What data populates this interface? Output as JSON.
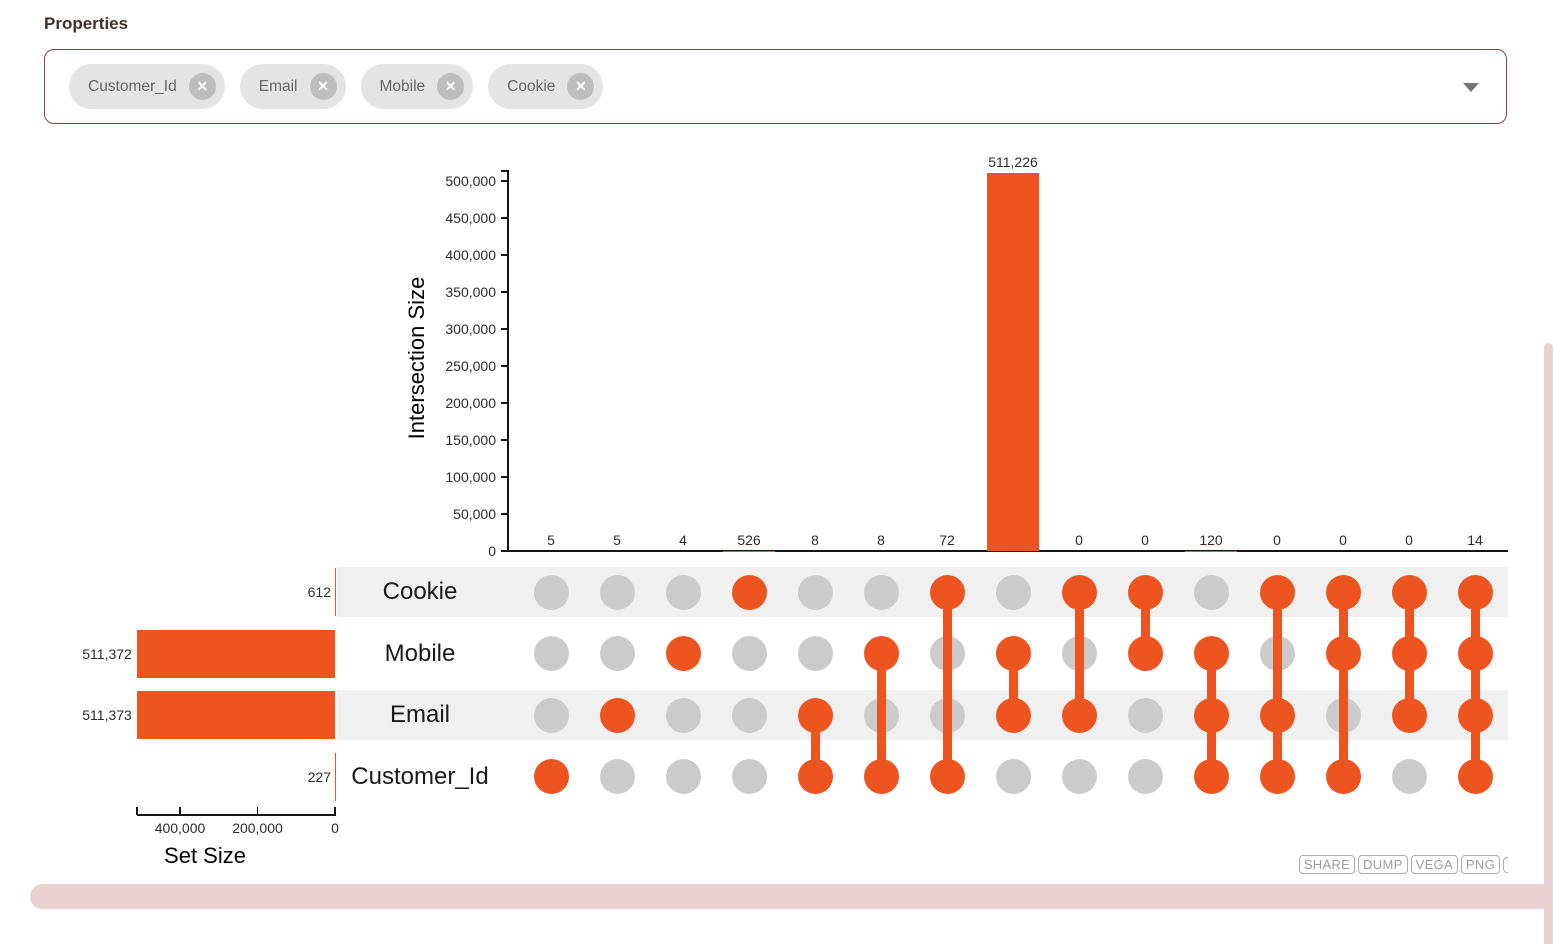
{
  "properties_panel": {
    "label": "Properties",
    "chips": [
      {
        "label": "Customer_Id"
      },
      {
        "label": "Email"
      },
      {
        "label": "Mobile"
      },
      {
        "label": "Cookie"
      }
    ],
    "remove_icon": "✕"
  },
  "chart_data": {
    "type": "upset",
    "intersection_axis": {
      "label": "Intersection Size",
      "max": 500000,
      "tick_values": [
        0,
        50000,
        100000,
        150000,
        200000,
        250000,
        300000,
        350000,
        400000,
        450000,
        500000
      ],
      "tick_labels": [
        "0",
        "50,000",
        "100,000",
        "150,000",
        "200,000",
        "250,000",
        "300,000",
        "350,000",
        "400,000",
        "450,000",
        "500,000"
      ]
    },
    "set_axis": {
      "label": "Set Size",
      "tick_values": [
        400000,
        200000,
        0
      ],
      "tick_labels": [
        "400,000",
        "200,000",
        "0"
      ]
    },
    "sets": [
      {
        "name": "Cookie",
        "size": 612,
        "size_label": "612"
      },
      {
        "name": "Mobile",
        "size": 511372,
        "size_label": "511,372"
      },
      {
        "name": "Email",
        "size": 511373,
        "size_label": "511,373"
      },
      {
        "name": "Customer_Id",
        "size": 227,
        "size_label": "227"
      }
    ],
    "intersections": [
      {
        "sets": [
          "Customer_Id"
        ],
        "value": 5,
        "label": "5"
      },
      {
        "sets": [
          "Email"
        ],
        "value": 5,
        "label": "5"
      },
      {
        "sets": [
          "Mobile"
        ],
        "value": 4,
        "label": "4"
      },
      {
        "sets": [
          "Cookie"
        ],
        "value": 526,
        "label": "526"
      },
      {
        "sets": [
          "Email",
          "Customer_Id"
        ],
        "value": 8,
        "label": "8"
      },
      {
        "sets": [
          "Mobile",
          "Customer_Id"
        ],
        "value": 8,
        "label": "8"
      },
      {
        "sets": [
          "Cookie",
          "Customer_Id"
        ],
        "value": 72,
        "label": "72"
      },
      {
        "sets": [
          "Mobile",
          "Email"
        ],
        "value": 511226,
        "label": "511,226"
      },
      {
        "sets": [
          "Cookie",
          "Email"
        ],
        "value": 0,
        "label": "0"
      },
      {
        "sets": [
          "Cookie",
          "Mobile"
        ],
        "value": 0,
        "label": "0"
      },
      {
        "sets": [
          "Mobile",
          "Email",
          "Customer_Id"
        ],
        "value": 120,
        "label": "120"
      },
      {
        "sets": [
          "Cookie",
          "Email",
          "Customer_Id"
        ],
        "value": 0,
        "label": "0"
      },
      {
        "sets": [
          "Cookie",
          "Mobile",
          "Customer_Id"
        ],
        "value": 0,
        "label": "0"
      },
      {
        "sets": [
          "Cookie",
          "Mobile",
          "Email"
        ],
        "value": 0,
        "label": "0"
      },
      {
        "sets": [
          "Cookie",
          "Mobile",
          "Email",
          "Customer_Id"
        ],
        "value": 14,
        "label": "14"
      }
    ],
    "colors": {
      "bar": "#ed5420",
      "dot_inactive": "#cbcbcb",
      "stripe": "#f0f0f0",
      "axis": "#151515"
    }
  },
  "toolbar": {
    "buttons": [
      {
        "label": "SHARE"
      },
      {
        "label": "DUMP"
      },
      {
        "label": "VEGA"
      },
      {
        "label": "PNG"
      }
    ]
  },
  "scrollbar_color": "#e9d2d1"
}
